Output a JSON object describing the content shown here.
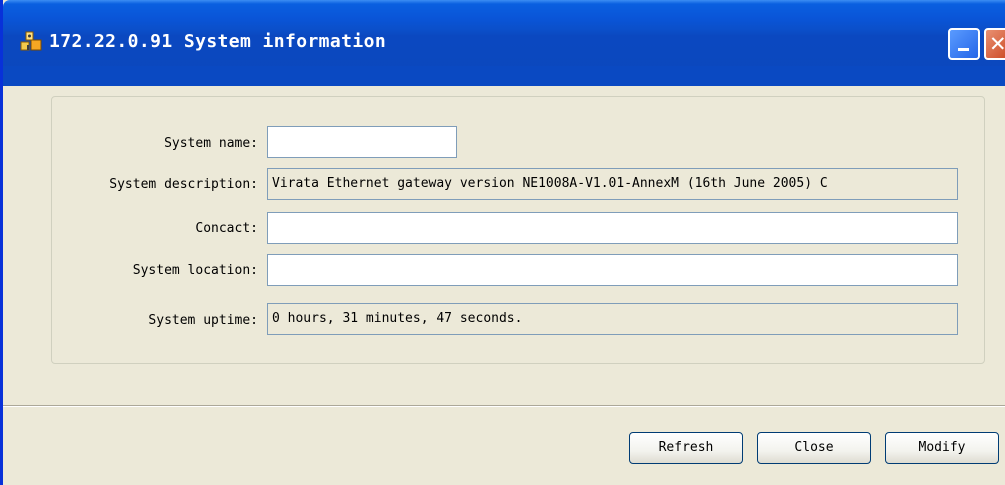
{
  "window": {
    "title": "172.22.0.91 System information",
    "icon": "network-monitor-icon",
    "title_bar_color": "#0b4fc9",
    "controls": {
      "minimize": "minimize-icon",
      "close": "close-icon"
    }
  },
  "form": {
    "system_name": {
      "label": "System name:",
      "value": ""
    },
    "system_description": {
      "label": "System description:",
      "value": "Virata Ethernet gateway version NE1008A-V1.01-AnnexM (16th June 2005)  C"
    },
    "contact": {
      "label": "Concact:",
      "value": ""
    },
    "system_location": {
      "label": "System location:",
      "value": ""
    },
    "system_uptime": {
      "label": "System uptime:",
      "value": "0 hours, 31 minutes, 47 seconds."
    }
  },
  "buttons": {
    "refresh": "Refresh",
    "close": "Close",
    "modify": "Modify"
  },
  "colors": {
    "dialog_background": "#ece9d8",
    "field_border": "#7f9db9",
    "button_border": "#003c74"
  }
}
